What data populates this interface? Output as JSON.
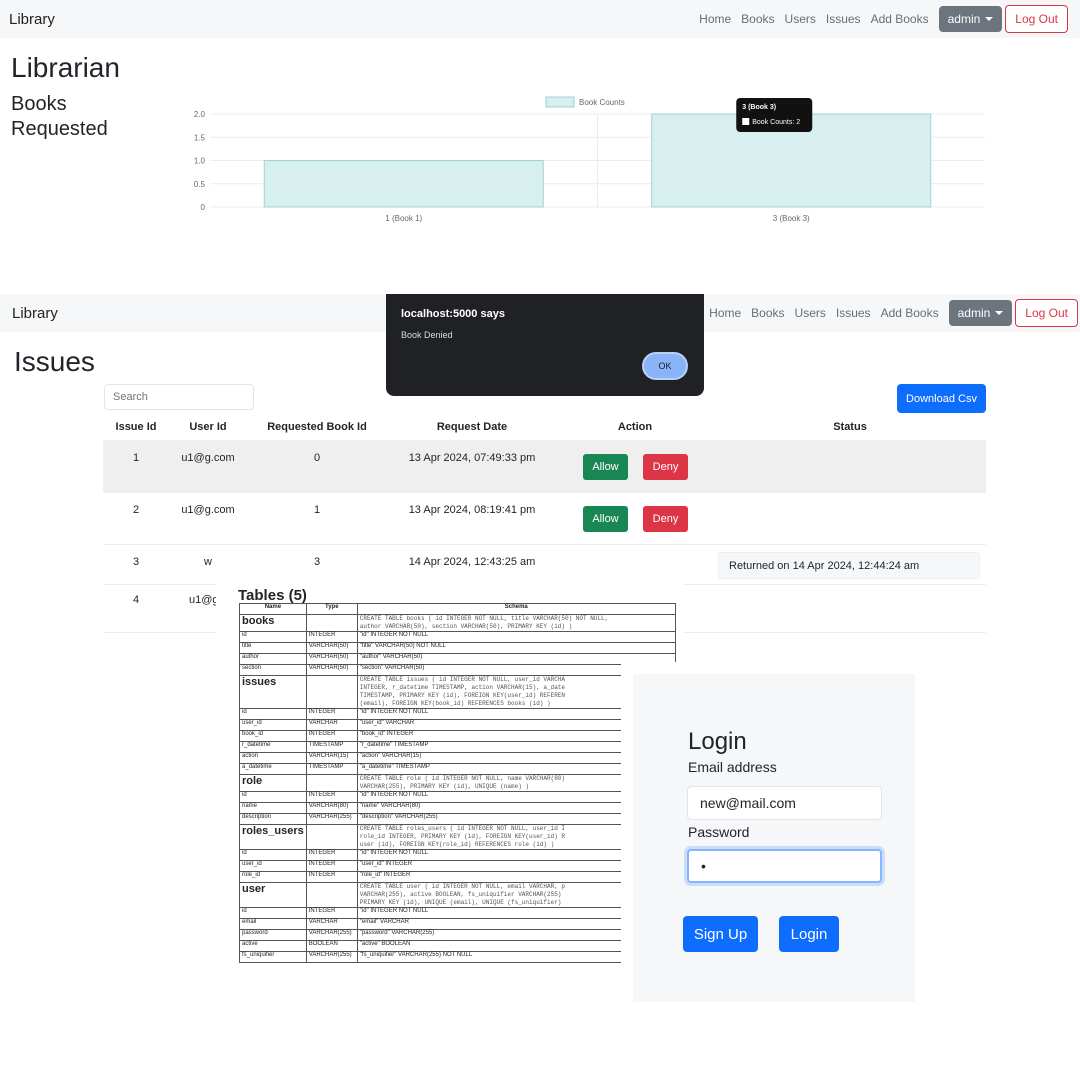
{
  "navbar": {
    "brand": "Library",
    "links": [
      "Home",
      "Books",
      "Users",
      "Issues",
      "Add Books"
    ],
    "admin_label": "admin",
    "logout_label": "Log Out"
  },
  "librarian": {
    "title": "Librarian",
    "subtitle_line1": "Books",
    "subtitle_line2": "Requested",
    "tooltip_title": "3 (Book 3)",
    "tooltip_label": "Book Counts: 2"
  },
  "chart_data": {
    "type": "bar",
    "categories": [
      "1 (Book 1)",
      "3 (Book 3)"
    ],
    "series": [
      {
        "name": "Book Counts",
        "values": [
          1,
          2
        ]
      }
    ],
    "yticks": [
      "0",
      "0.5",
      "1.0",
      "1.5",
      "2.0"
    ],
    "ylim": [
      0,
      2
    ],
    "legend": "top",
    "grid": true,
    "bar_color": "#d8efef",
    "bar_border": "#9fd3d3"
  },
  "issues": {
    "title": "Issues",
    "search_placeholder": "Search",
    "download_label": "Download Csv",
    "headers": [
      "Issue Id",
      "User Id",
      "Requested Book Id",
      "Request Date",
      "Action",
      "Status"
    ],
    "rows": [
      {
        "id": "1",
        "user": "u1@g.com",
        "book": "0",
        "date": "13 Apr 2024, 07:49:33 pm",
        "allow": "Allow",
        "deny": "Deny"
      },
      {
        "id": "2",
        "user": "u1@g.com",
        "book": "1",
        "date": "13 Apr 2024, 08:19:41 pm",
        "allow": "Allow",
        "deny": "Deny"
      },
      {
        "id": "3",
        "user": "w",
        "book": "3",
        "date": "14 Apr 2024, 12:43:25 am",
        "status": "Returned on 14 Apr 2024, 12:44:24 am"
      },
      {
        "id": "4",
        "user": "u1@g.c"
      }
    ],
    "dialog": {
      "title": "localhost:5000 says",
      "message": "Book Denied",
      "ok": "OK"
    }
  },
  "tables": {
    "title": "Tables (5)",
    "headers": [
      "Name",
      "Type",
      "Schema"
    ],
    "groups": [
      {
        "name": "books",
        "schema": [
          "CREATE TABLE books ( id INTEGER NOT NULL, title VARCHAR(50) NOT NULL,",
          "author VARCHAR(50), section VARCHAR(50), PRIMARY KEY (id) )"
        ],
        "columns": [
          [
            "id",
            "INTEGER",
            "\"id\" INTEGER NOT NULL"
          ],
          [
            "title",
            "VARCHAR(50)",
            "\"title\" VARCHAR(50) NOT NULL"
          ],
          [
            "author",
            "VARCHAR(50)",
            "\"author\" VARCHAR(50)"
          ],
          [
            "section",
            "VARCHAR(50)",
            "\"section\" VARCHAR(50)"
          ]
        ]
      },
      {
        "name": "issues",
        "schema": [
          "CREATE TABLE issues ( id INTEGER NOT NULL, user_id VARCHA",
          "INTEGER, r_datetime TIMESTAMP, action VARCHAR(15), a_date",
          "TIMESTAMP, PRIMARY KEY (id), FOREIGN KEY(user_id) REFEREN",
          "(email), FOREIGN KEY(book_id) REFERENCES books (id) )"
        ],
        "columns": [
          [
            "id",
            "INTEGER",
            "\"id\" INTEGER NOT NULL"
          ],
          [
            "user_id",
            "VARCHAR",
            "\"user_id\" VARCHAR"
          ],
          [
            "book_id",
            "INTEGER",
            "\"book_id\" INTEGER"
          ],
          [
            "r_datetime",
            "TIMESTAMP",
            "\"r_datetime\" TIMESTAMP"
          ],
          [
            "action",
            "VARCHAR(15)",
            "\"action\" VARCHAR(15)"
          ],
          [
            "a_datetime",
            "TIMESTAMP",
            "\"a_datetime\" TIMESTAMP"
          ]
        ]
      },
      {
        "name": "role",
        "schema": [
          "CREATE TABLE role ( id INTEGER NOT NULL, name VARCHAR(80)",
          "VARCHAR(255), PRIMARY KEY (id), UNIQUE (name) )"
        ],
        "columns": [
          [
            "id",
            "INTEGER",
            "\"id\" INTEGER NOT NULL"
          ],
          [
            "name",
            "VARCHAR(80)",
            "\"name\" VARCHAR(80)"
          ],
          [
            "description",
            "VARCHAR(255)",
            "\"description\" VARCHAR(255)"
          ]
        ]
      },
      {
        "name": "roles_users",
        "schema": [
          "CREATE TABLE roles_users ( id INTEGER NOT NULL, user_id I",
          "role_id INTEGER, PRIMARY KEY (id), FOREIGN KEY(user_id) R",
          "user (id), FOREIGN KEY(role_id) REFERENCES role (id) )"
        ],
        "columns": [
          [
            "id",
            "INTEGER",
            "\"id\" INTEGER NOT NULL"
          ],
          [
            "user_id",
            "INTEGER",
            "\"user_id\" INTEGER"
          ],
          [
            "role_id",
            "INTEGER",
            "\"role_id\" INTEGER"
          ]
        ]
      },
      {
        "name": "user",
        "schema": [
          "CREATE TABLE user ( id INTEGER NOT NULL, email VARCHAR, p",
          "VARCHAR(255), active BOOLEAN, fs_uniquifier VARCHAR(255)",
          "PRIMARY KEY (id), UNIQUE (email), UNIQUE (fs_uniquifier)"
        ],
        "columns": [
          [
            "id",
            "INTEGER",
            "\"id\" INTEGER NOT NULL"
          ],
          [
            "email",
            "VARCHAR",
            "\"email\" VARCHAR"
          ],
          [
            "password",
            "VARCHAR(255)",
            "\"password\" VARCHAR(255)"
          ],
          [
            "active",
            "BOOLEAN",
            "\"active\" BOOLEAN"
          ],
          [
            "fs_uniquifier",
            "VARCHAR(255)",
            "\"fs_uniquifier\" VARCHAR(255) NOT NULL"
          ]
        ]
      }
    ]
  },
  "login": {
    "title": "Login",
    "email_label": "Email address",
    "email_value": "new@mail.com",
    "password_label": "Password",
    "password_value": "•",
    "signup_label": "Sign Up",
    "login_label": "Login"
  }
}
